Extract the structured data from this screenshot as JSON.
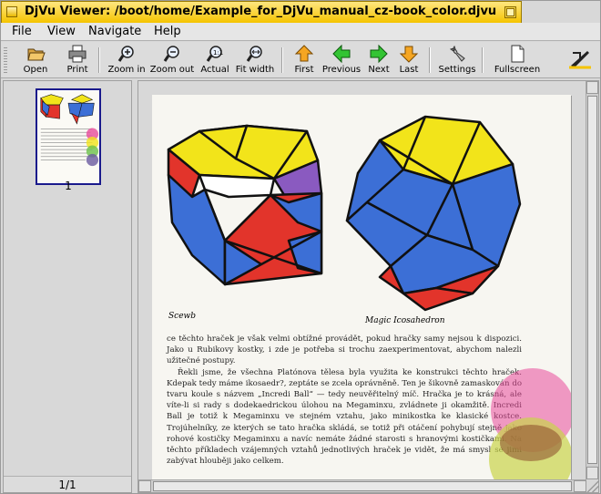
{
  "window": {
    "title": "DjVu Viewer: /boot/home/Example_for_DjVu_manual_cz-book_color.djvu"
  },
  "menu": [
    "File",
    "View",
    "Navigate",
    "Help"
  ],
  "toolbar": {
    "open": "Open",
    "print": "Print",
    "zoom_in": "Zoom in",
    "zoom_out": "Zoom out",
    "actual": "Actual",
    "fit_width": "Fit width",
    "first": "First",
    "previous": "Previous",
    "next": "Next",
    "last": "Last",
    "settings": "Settings",
    "fullscreen": "Fullscreen"
  },
  "thumbnails": {
    "pages": [
      "1"
    ],
    "page_count": "1/1"
  },
  "document": {
    "caption_left": "Scewb",
    "caption_right": "Magic Icosahedron",
    "paragraph_1": "ce těchto hraček je však velmi obtížné provádět, pokud hračky samy nejsou k dispozici. Jako u Rubikovy kostky, i zde je potřeba si trochu zaexperimentovat, abychom nalezli užitečné postupy.",
    "paragraph_2": "Řekli jsme, že všechna Platónova tělesa byla využita ke konstrukci těchto hraček. Kdepak tedy máme ikosaedr?, zeptáte se zcela oprávněně. Ten je šikovně zamaskován do tvaru koule s názvem „Incredi Ball“ — tedy neuvěřitelný míč. Hračka je to krásná, ale víte-li si rady s dodekaedrickou úlohou na Megaminxu, zvládnete ji okamžitě. Incredi Ball je totiž k Megaminxu ve stejném vztahu, jako minikostka ke klasické kostce. Trojúhelníky, ze kterých se tato hračka skládá, se totiž při otáčení pohybují stejně jako rohové kostičky Megaminxu a navíc nemáte žádné starosti s hranovými kostičkami. Na těchto příkladech vzájemných vztahů jednotlivých hraček je vidět, že má smysl se jimi zabývat hlouběji jako celkem."
  },
  "colors": {
    "title_bar": "#f5c400",
    "cube_yellow": "#f2e41a",
    "cube_blue": "#3c6fd6",
    "cube_red": "#e2342b",
    "cube_purple": "#8a5ac0",
    "thumb_selection": "#1a1a8c"
  }
}
